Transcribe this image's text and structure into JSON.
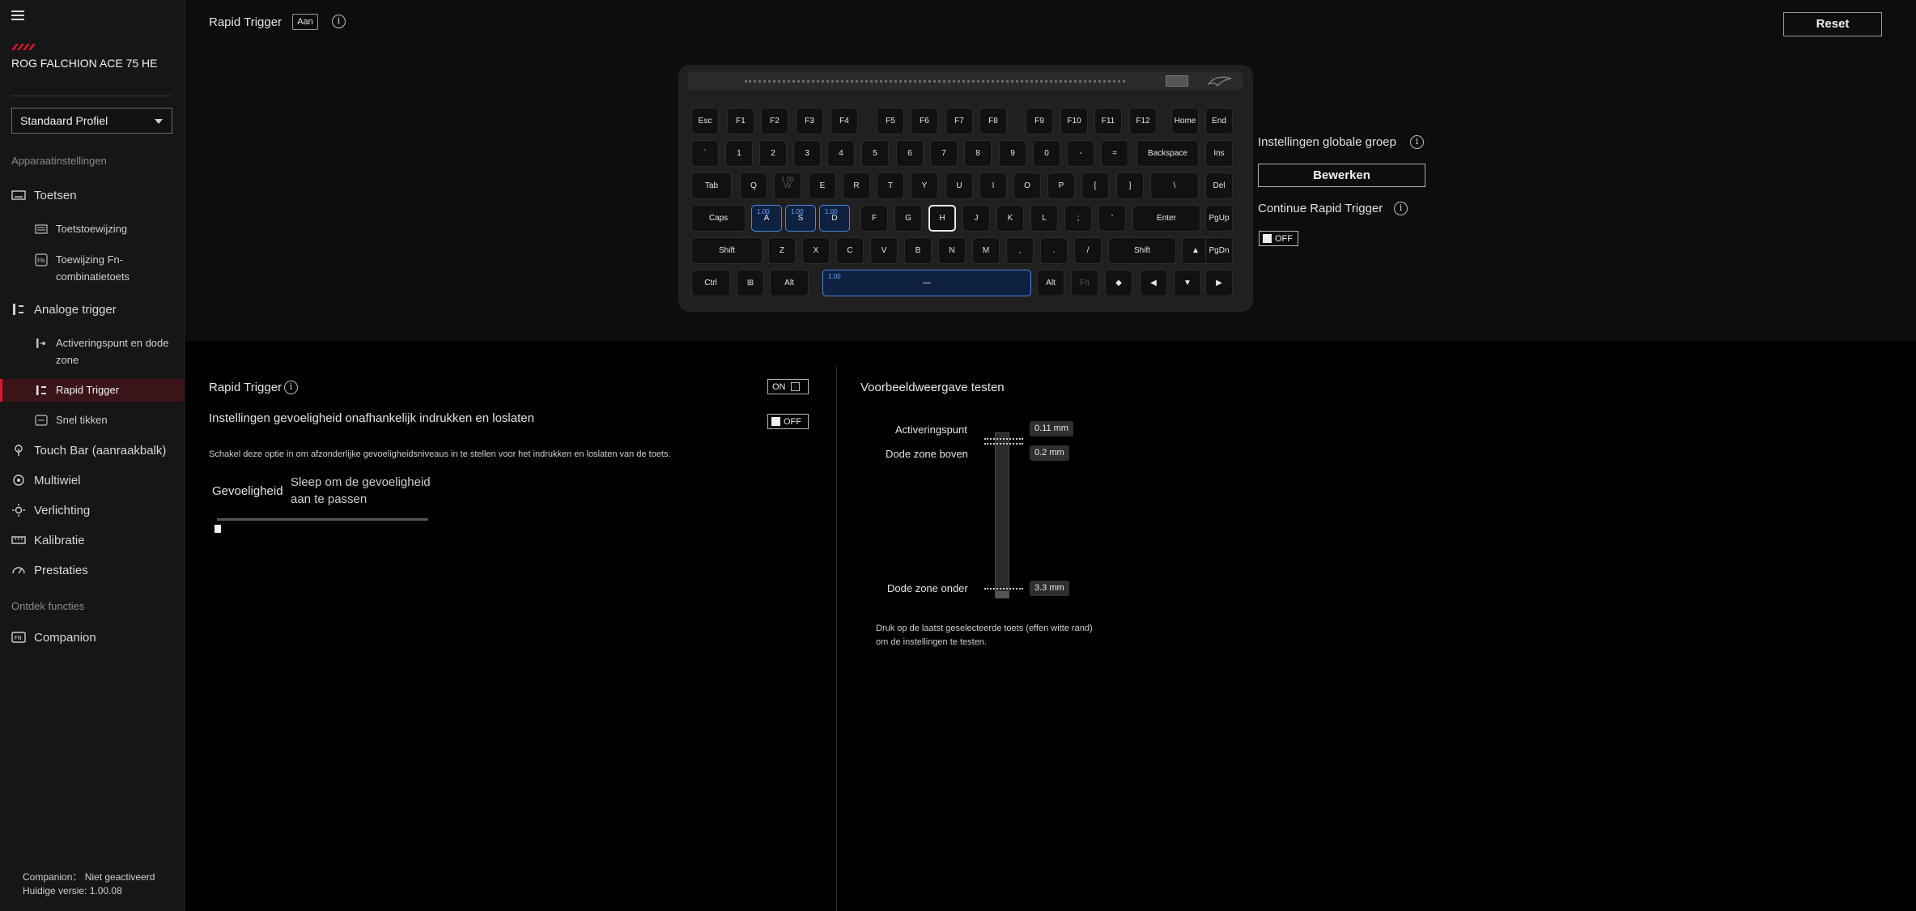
{
  "sidebar": {
    "device_name": "ROG FALCHION ACE 75 HE",
    "profile": "Standaard Profiel",
    "section_device": "Apparaatinstellingen",
    "section_discover": "Ontdek functies",
    "items": {
      "toetsen": "Toetsen",
      "toetstoewijzing": "Toetstoewijzing",
      "fn": "Toewijzing Fn-combinatietoets",
      "analoge": "Analoge trigger",
      "activering": "Activeringspunt en dode zone",
      "rapid": "Rapid Trigger",
      "snel": "Snel tikken",
      "touchbar": "Touch Bar (aanraakbalk)",
      "multiwiel": "Multiwiel",
      "verlichting": "Verlichting",
      "kalibratie": "Kalibratie",
      "prestaties": "Prestaties",
      "companion": "Companion"
    },
    "footer_status": "Companion： Niet geactiveerd",
    "footer_version": "Huidige versie: 1.00.08"
  },
  "header": {
    "title": "Rapid Trigger",
    "status_badge": "Aan",
    "reset": "Reset"
  },
  "keyboard": {
    "rows": [
      [
        "Esc",
        "F1",
        "F2",
        "F3",
        "F4",
        "F5",
        "F6",
        "F7",
        "F8",
        "F9",
        "F10",
        "F11",
        "F12",
        "Home",
        "End"
      ],
      [
        "`",
        "1",
        "2",
        "3",
        "4",
        "5",
        "6",
        "7",
        "8",
        "9",
        "0",
        "-",
        "=",
        "Backspace",
        "Ins"
      ],
      [
        "Tab",
        "Q",
        "W",
        "E",
        "R",
        "T",
        "Y",
        "U",
        "I",
        "O",
        "P",
        "[",
        "]",
        "\\",
        "Del"
      ],
      [
        "Caps",
        "A",
        "S",
        "D",
        "F",
        "G",
        "H",
        "J",
        "K",
        "L",
        ";",
        "'",
        "Enter",
        "PgUp"
      ],
      [
        "Shift",
        "Z",
        "X",
        "C",
        "V",
        "B",
        "N",
        "M",
        ",",
        ".",
        "/",
        "Shift",
        "▲",
        "PgDn"
      ],
      [
        "Ctrl",
        "⊞",
        "Alt",
        "—",
        "Alt",
        "Fn",
        "◆",
        "◀",
        "▼",
        "▶"
      ]
    ],
    "key_value": "1.00"
  },
  "global": {
    "group_label": "Instellingen globale groep",
    "edit_button": "Bewerken",
    "continue_label": "Continue Rapid Trigger",
    "continue_state": "OFF"
  },
  "settings": {
    "rt_label": "Rapid Trigger",
    "rt_state": "ON",
    "separate_label": "Instellingen gevoeligheid onafhankelijk indrukken en loslaten",
    "separate_state": "OFF",
    "separate_desc": "Schakel deze optie in om afzonderlijke gevoeligheidsniveaus in te stellen voor het indrukken en loslaten van de toets.",
    "sensitivity_label": "Gevoeligheid",
    "sensitivity_hint_1": "Sleep om de gevoeligheid",
    "sensitivity_hint_2": "aan te passen",
    "sensitivity_level": 0
  },
  "preview": {
    "title": "Voorbeeldweergave testen",
    "activation_label": "Activeringspunt",
    "activation_value": "0.11 mm",
    "top_label": "Dode zone boven",
    "top_value": "0.2 mm",
    "bottom_label": "Dode zone onder",
    "bottom_value": "3.3 mm",
    "hint_1": "Druk op de laatst geselecteerde toets (effen witte rand)",
    "hint_2": "om de instellingen te testen."
  },
  "colors": {
    "accent": "#e0162b",
    "selected_key": "#4a89e0"
  }
}
